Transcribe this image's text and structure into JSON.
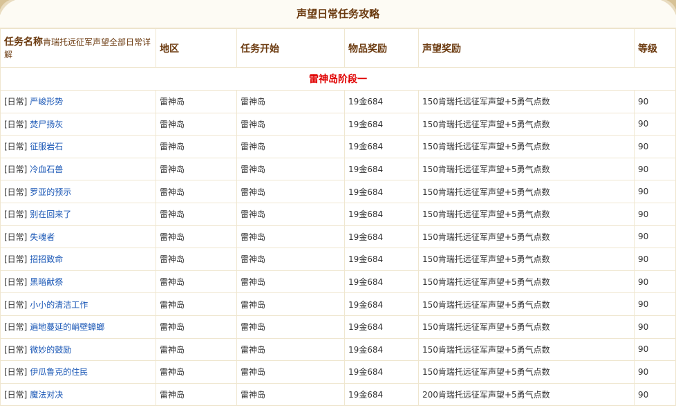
{
  "page_title": "声望日常任务攻略",
  "headers": {
    "name_main": "任务名称",
    "name_sub": "肯瑞托远征军声望全部日常详解",
    "region": "地区",
    "start": "任务开始",
    "item_reward": "物品奖励",
    "rep_reward": "声望奖励",
    "level": "等级"
  },
  "section_title": "雷神岛阶段一",
  "rows": [
    {
      "tag": "[日常]",
      "name": "严峻形势",
      "region": "雷神岛",
      "start": "雷神岛",
      "item": "19金684",
      "rep": "150肯瑞托远征军声望+5勇气点数",
      "level": "90"
    },
    {
      "tag": "[日常]",
      "name": "焚尸扬灰",
      "region": "雷神岛",
      "start": "雷神岛",
      "item": "19金684",
      "rep": "150肯瑞托远征军声望+5勇气点数",
      "level": "90"
    },
    {
      "tag": "[日常]",
      "name": "征服岩石",
      "region": "雷神岛",
      "start": "雷神岛",
      "item": "19金684",
      "rep": "150肯瑞托远征军声望+5勇气点数",
      "level": "90"
    },
    {
      "tag": "[日常]",
      "name": "冷血石兽",
      "region": "雷神岛",
      "start": "雷神岛",
      "item": "19金684",
      "rep": "150肯瑞托远征军声望+5勇气点数",
      "level": "90"
    },
    {
      "tag": "[日常]",
      "name": "罗亚的预示",
      "region": "雷神岛",
      "start": "雷神岛",
      "item": "19金684",
      "rep": "150肯瑞托远征军声望+5勇气点数",
      "level": "90"
    },
    {
      "tag": "[日常]",
      "name": "别在回来了",
      "region": "雷神岛",
      "start": "雷神岛",
      "item": "19金684",
      "rep": "150肯瑞托远征军声望+5勇气点数",
      "level": "90"
    },
    {
      "tag": "[日常]",
      "name": "失魂者",
      "region": "雷神岛",
      "start": "雷神岛",
      "item": "19金684",
      "rep": "150肯瑞托远征军声望+5勇气点数",
      "level": "90"
    },
    {
      "tag": "[日常]",
      "name": "招招致命",
      "region": "雷神岛",
      "start": "雷神岛",
      "item": "19金684",
      "rep": "150肯瑞托远征军声望+5勇气点数",
      "level": "90"
    },
    {
      "tag": "[日常]",
      "name": "黑暗献祭",
      "region": "雷神岛",
      "start": "雷神岛",
      "item": "19金684",
      "rep": "150肯瑞托远征军声望+5勇气点数",
      "level": "90"
    },
    {
      "tag": "[日常]",
      "name": "小小的清洁工作",
      "region": "雷神岛",
      "start": "雷神岛",
      "item": "19金684",
      "rep": "150肯瑞托远征军声望+5勇气点数",
      "level": "90"
    },
    {
      "tag": "[日常]",
      "name": "遍地蔓延的峭壁蟑螂",
      "region": "雷神岛",
      "start": "雷神岛",
      "item": "19金684",
      "rep": "150肯瑞托远征军声望+5勇气点数",
      "level": "90"
    },
    {
      "tag": "[日常]",
      "name": "微妙的鼓励",
      "region": "雷神岛",
      "start": "雷神岛",
      "item": "19金684",
      "rep": "150肯瑞托远征军声望+5勇气点数",
      "level": "90"
    },
    {
      "tag": "[日常]",
      "name": "伊瓜鲁克的住民",
      "region": "雷神岛",
      "start": "雷神岛",
      "item": "19金684",
      "rep": "150肯瑞托远征军声望+5勇气点数",
      "level": "90"
    },
    {
      "tag": "[日常]",
      "name": "魔法对决",
      "region": "雷神岛",
      "start": "雷神岛",
      "item": "19金684",
      "rep": "200肯瑞托远征军声望+5勇气点数",
      "level": "90"
    }
  ]
}
